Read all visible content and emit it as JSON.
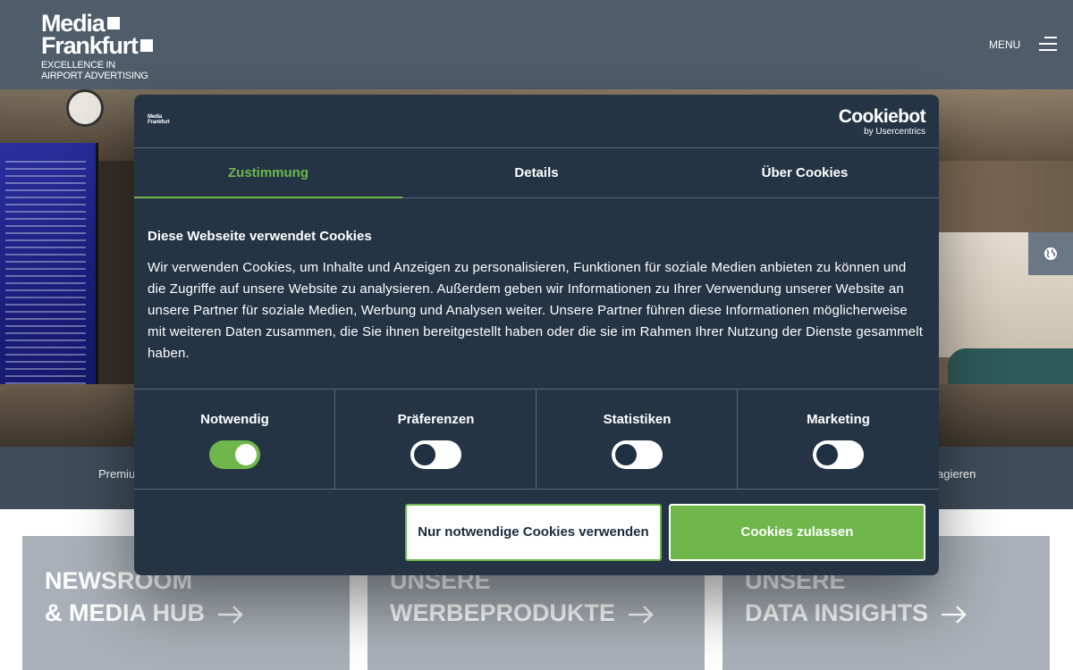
{
  "header": {
    "logo": {
      "line1": "Media",
      "line2": "Frankfurt",
      "tagline1": "EXCELLENCE IN",
      "tagline2": "AIRPORT ADVERTISING"
    },
    "menu_label": "MENU",
    "menu_icon": "hamburger-icon"
  },
  "hero": {
    "language_icon": "globe-icon"
  },
  "subnav": {
    "left_text": "Premiu",
    "right_text": "agieren"
  },
  "tiles": [
    {
      "line1": "NEWSROOM",
      "line2": "& MEDIA HUB",
      "icon": "arrow-right-icon"
    },
    {
      "line1": "UNSERE",
      "line2": "WERBEPRODUKTE",
      "icon": "arrow-right-icon"
    },
    {
      "line1": "UNSERE",
      "line2": "DATA INSIGHTS",
      "icon": "arrow-right-icon"
    }
  ],
  "cookie_dialog": {
    "brand": {
      "name": "Cookiebot",
      "by": "by Usercentrics",
      "mini_logo_line1": "Media",
      "mini_logo_line2": "Frankfurt"
    },
    "tabs": [
      {
        "label": "Zustimmung",
        "active": true
      },
      {
        "label": "Details",
        "active": false
      },
      {
        "label": "Über Cookies",
        "active": false
      }
    ],
    "heading": "Diese Webseite verwendet Cookies",
    "body": "Wir verwenden Cookies, um Inhalte und Anzeigen zu personalisieren, Funktionen für soziale Medien anbieten zu können und die Zugriffe auf unsere Website zu analysieren. Außerdem geben wir Informationen zu Ihrer Verwendung unserer Website an unsere Partner für soziale Medien, Werbung und Analysen weiter. Unsere Partner führen diese Informationen möglicherweise mit weiteren Daten zusammen, die Sie ihnen bereitgestellt haben oder die sie im Rahmen Ihrer Nutzung der Dienste gesammelt haben.",
    "toggles": [
      {
        "label": "Notwendig",
        "checked": true
      },
      {
        "label": "Präferenzen",
        "checked": false
      },
      {
        "label": "Statistiken",
        "checked": false
      },
      {
        "label": "Marketing",
        "checked": false
      }
    ],
    "buttons": {
      "necessary_only": "Nur notwendige Cookies verwenden",
      "allow_all": "Cookies zulassen"
    }
  },
  "colors": {
    "header_bg": "#4f5d6b",
    "dialog_bg": "#243445",
    "accent_green": "#6fb74b",
    "tile_bg": "#a9b0b7"
  }
}
